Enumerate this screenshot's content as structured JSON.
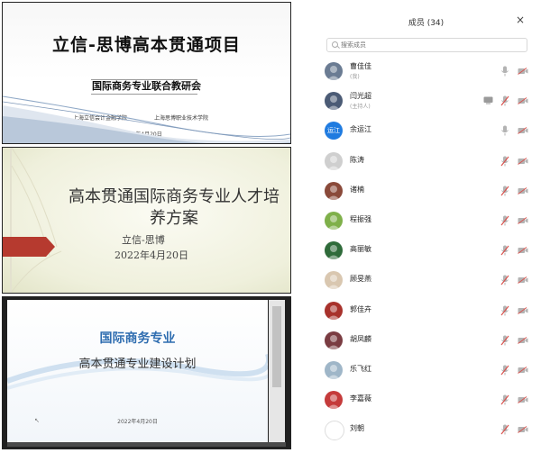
{
  "slides": {
    "slide1": {
      "title": "立信-思博高本贯通项目",
      "subtitle": "国际商务专业联合教研会",
      "school_left": "上海立信会计金融学院",
      "school_right": "上海思博职业技术学院",
      "date": "2022年4月20日"
    },
    "slide2": {
      "title": "高本贯通国际商务专业人才培养方案",
      "author": "立信-思博",
      "date": "2022年4月20日"
    },
    "slide3": {
      "title": "国际商务专业",
      "subtitle": "高本贯通专业建设计划",
      "date": "2022年4月20日"
    }
  },
  "panel": {
    "title": "成员 (34)",
    "close_icon": "×",
    "search_placeholder": "搜索成员",
    "members": [
      {
        "name": "曹佳佳",
        "role": "(我)",
        "avatar_color": "#6b7c93",
        "mic": "on",
        "screen": false
      },
      {
        "name": "闫光超",
        "role": "(主持人)",
        "avatar_color": "#4b5b75",
        "mic": "off",
        "screen": true
      },
      {
        "name": "余运江",
        "role": "",
        "avatar_color": "#1f7be0",
        "avatar_text": "运江",
        "mic": "on",
        "screen": false
      },
      {
        "name": "陈涛",
        "role": "",
        "avatar_color": "#cfcfcf",
        "mic": "off",
        "screen": false
      },
      {
        "name": "诸楠",
        "role": "",
        "avatar_color": "#8a4a3a",
        "mic": "off",
        "screen": false
      },
      {
        "name": "程振强",
        "role": "",
        "avatar_color": "#7fb04a",
        "mic": "off",
        "screen": false
      },
      {
        "name": "高丽敏",
        "role": "",
        "avatar_color": "#2f6b3a",
        "mic": "off",
        "screen": false
      },
      {
        "name": "顾旻燕",
        "role": "",
        "avatar_color": "#d9c7b0",
        "mic": "off",
        "screen": false
      },
      {
        "name": "郭佳卉",
        "role": "",
        "avatar_color": "#a8322c",
        "mic": "off",
        "screen": false
      },
      {
        "name": "胡凤麟",
        "role": "",
        "avatar_color": "#7a3c42",
        "mic": "off",
        "screen": false
      },
      {
        "name": "乐飞红",
        "role": "",
        "avatar_color": "#9fb6c8",
        "mic": "off",
        "screen": false
      },
      {
        "name": "李嘉薇",
        "role": "",
        "avatar_color": "#c53b3b",
        "mic": "off",
        "screen": false
      },
      {
        "name": "刘朝",
        "role": "",
        "avatar_color": "#ffffff",
        "mic": "off",
        "screen": false
      }
    ]
  },
  "colors": {
    "accent_blue": "#2f6db0",
    "mic_muted": "#d9534f",
    "icon_gray": "#b3b3b3"
  }
}
